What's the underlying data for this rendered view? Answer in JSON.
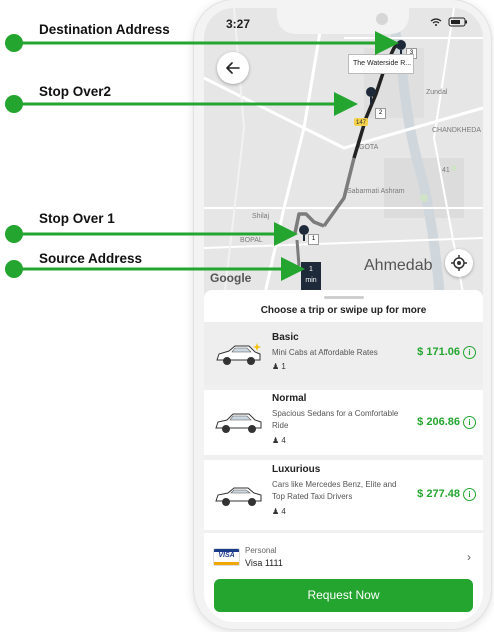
{
  "annotations": {
    "destination": "Destination Address",
    "stop2": "Stop Over2",
    "stop1": "Stop Over 1",
    "source": "Source Address"
  },
  "status_bar": {
    "time": "3:27"
  },
  "map": {
    "destination_callout": "The Waterside R...",
    "eta_value": "1",
    "eta_unit": "min",
    "stop1_label": "1",
    "stop2_label": "2",
    "dest_label": "3",
    "city": "Ahmedab",
    "attribution": "Google",
    "labels": {
      "area1": "CHANDKHEDA",
      "area2": "Sabarmati Ashram",
      "area3": "Shilaj",
      "area4": "BOPAL",
      "area5": "GOTA",
      "road": "147",
      "place": "Zundal",
      "road2": "41"
    }
  },
  "sheet": {
    "title": "Choose a trip or swipe up for more",
    "rides": [
      {
        "name": "Basic",
        "desc": "Mini Cabs at Affordable Rates",
        "seats": "1",
        "price": "$ 171.06"
      },
      {
        "name": "Normal",
        "desc": "Spacious Sedans for a Comfortable Ride",
        "seats": "4",
        "price": "$ 206.86"
      },
      {
        "name": "Luxurious",
        "desc": "Cars like Mercedes Benz, Elite and Top Rated Taxi Drivers",
        "seats": "4",
        "price": "$ 277.48"
      }
    ],
    "payment": {
      "type": "Personal",
      "card": "Visa 1111",
      "brand": "VISA"
    },
    "request_button": "Request Now"
  },
  "colors": {
    "accent": "#23a52f",
    "route": "#222222"
  }
}
